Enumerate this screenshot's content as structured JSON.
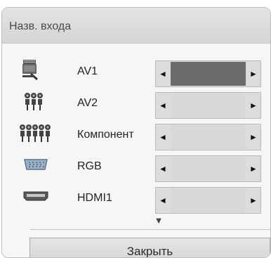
{
  "dialog": {
    "title": "Назв. входа",
    "close_label": "Закрыть"
  },
  "inputs": [
    {
      "label": "AV1",
      "icon": "scart-icon",
      "selected": true
    },
    {
      "label": "AV2",
      "icon": "rca-composite-icon",
      "selected": false
    },
    {
      "label": "Компонент",
      "icon": "rca-component-icon",
      "selected": false
    },
    {
      "label": "RGB",
      "icon": "vga-port-icon",
      "selected": false
    },
    {
      "label": "HDMI1",
      "icon": "hdmi-port-icon",
      "selected": false
    }
  ],
  "arrows": {
    "left": "◄",
    "right": "►",
    "down": "▼"
  }
}
